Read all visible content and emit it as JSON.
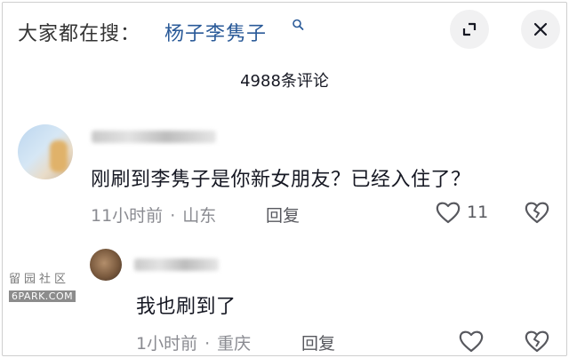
{
  "search": {
    "prefix": "大家都在搜：",
    "term": "杨子李隽子"
  },
  "header": {
    "expand_icon": "expand-icon",
    "close_icon": "close-icon"
  },
  "comment_count": "4988条评论",
  "comments": [
    {
      "text": "刚刷到李隽子是你新女朋友？已经入住了？",
      "time": "11小时前",
      "location": "山东",
      "reply_label": "回复",
      "likes": "11"
    },
    {
      "text": "我也刷到了",
      "time": "1小时前",
      "location": "重庆",
      "reply_label": "回复"
    }
  ],
  "watermark": {
    "top": "留园社区",
    "bottom": "6PARK.COM"
  },
  "colors": {
    "search_term": "#2a5a98",
    "meta": "#8a8b91",
    "button_bg": "#f1f1f2"
  }
}
